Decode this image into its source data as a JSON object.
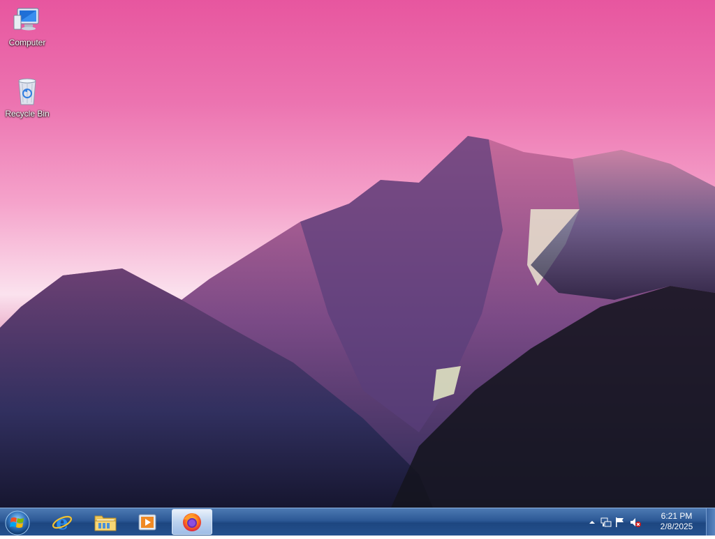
{
  "desktop": {
    "icons": [
      {
        "label": "Computer",
        "icon": "computer-icon"
      },
      {
        "label": "Recycle Bin",
        "icon": "recycle-bin-icon"
      }
    ]
  },
  "taskbar": {
    "start_label": "Start",
    "pinned": [
      {
        "name": "Internet Explorer",
        "icon": "internet-explorer-icon"
      },
      {
        "name": "Windows Explorer",
        "icon": "file-explorer-icon"
      },
      {
        "name": "Windows Media Player",
        "icon": "media-player-icon"
      },
      {
        "name": "Firefox",
        "icon": "firefox-icon",
        "active": true
      }
    ],
    "tray": {
      "icons": [
        "show-hidden-icons-chevron",
        "network-icon",
        "action-center-flag-icon",
        "volume-muted-icon"
      ],
      "time": "6:21 PM",
      "date": "2/8/2025"
    }
  },
  "colors": {
    "sky_top": "#e7569f",
    "taskbar": "#2c5895"
  }
}
